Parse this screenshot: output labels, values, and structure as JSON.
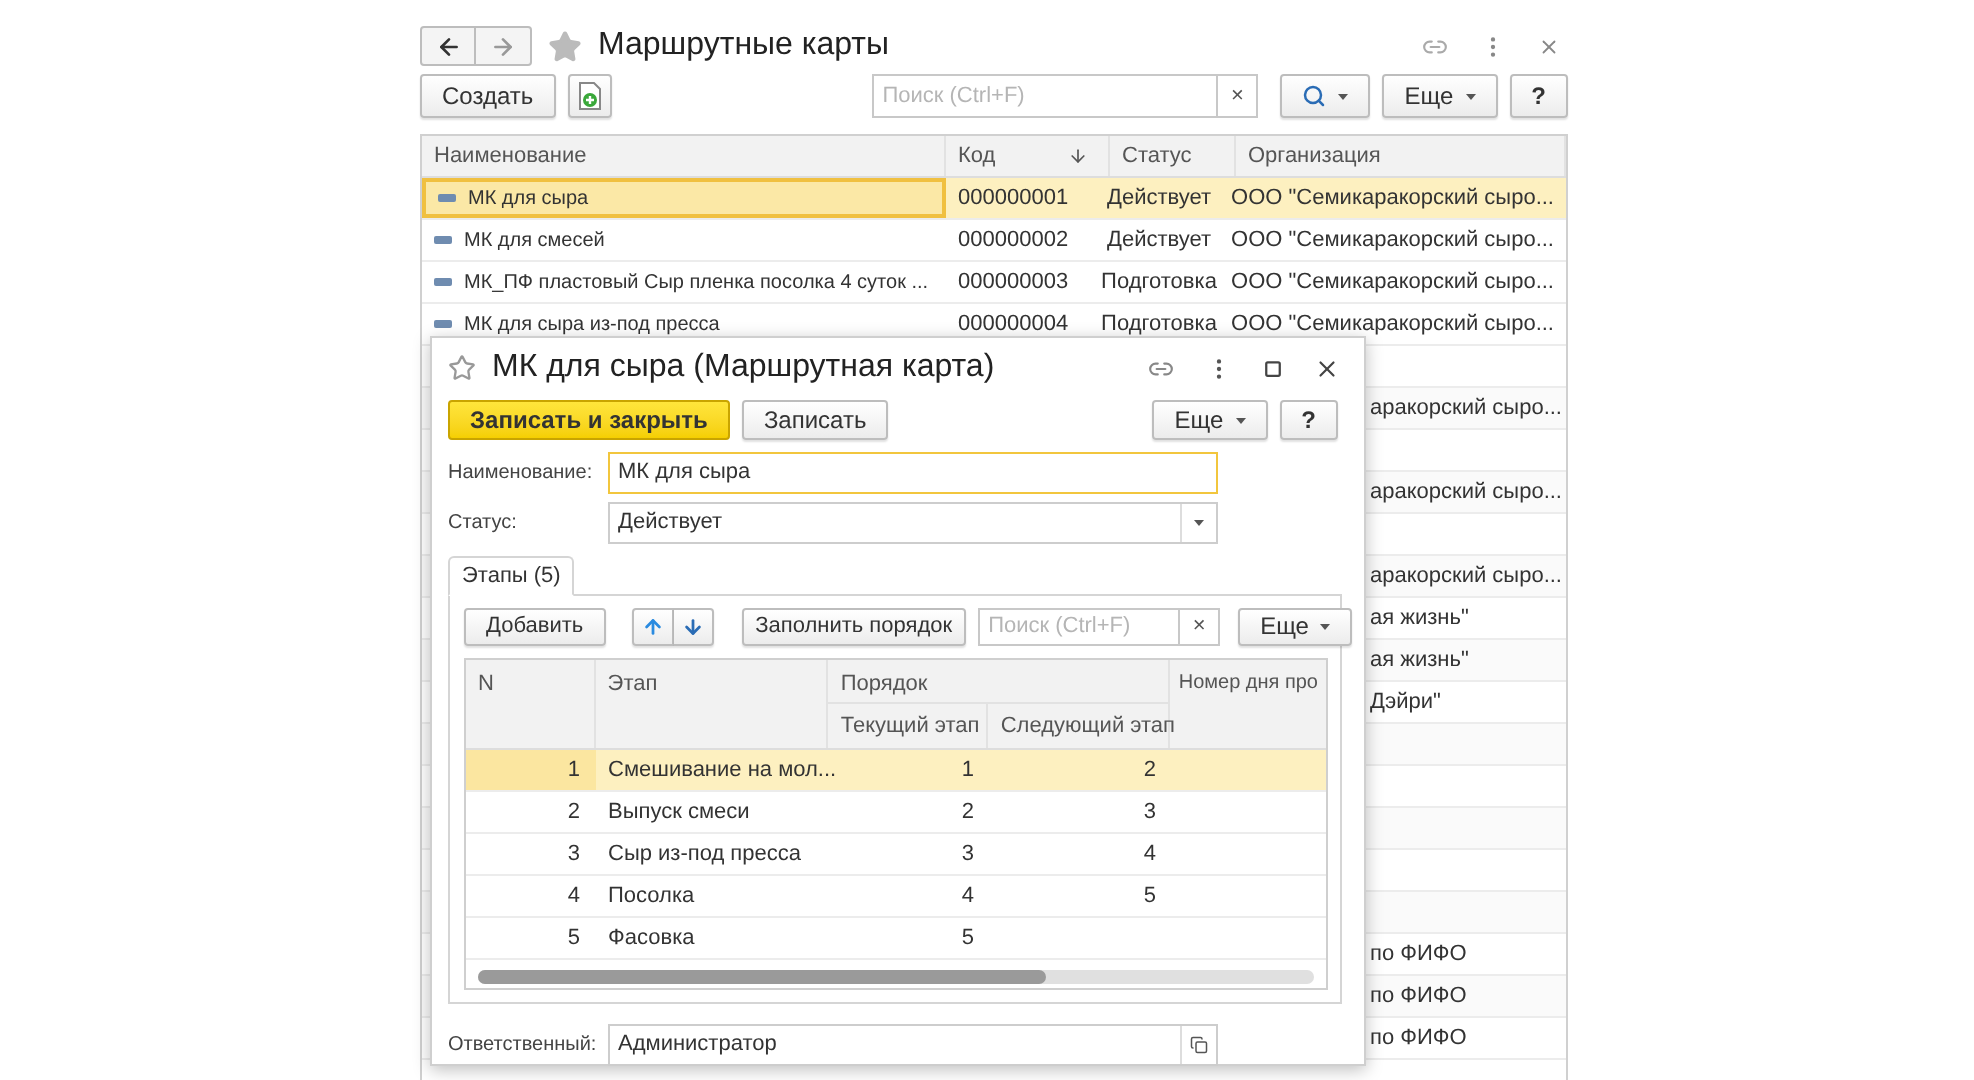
{
  "window": {
    "title": "Маршрутные карты",
    "favorite": false
  },
  "toolbar": {
    "create_button": "Создать",
    "search": {
      "placeholder": "Поиск (Ctrl+F)"
    },
    "clear_button": "×",
    "more_button": "Еще",
    "help_button": "?"
  },
  "list": {
    "columns": [
      {
        "label": "Наименование",
        "sorted": false
      },
      {
        "label": "Код",
        "sorted": true
      },
      {
        "label": "Статус",
        "sorted": false
      },
      {
        "label": "Организация",
        "sorted": false
      }
    ],
    "rows": [
      {
        "name": "МК для сыра",
        "code": "000000001",
        "status": "Действует",
        "organization": "ООО \"Семикаракорский сыро...",
        "selected": true
      },
      {
        "name": "МК для смесей",
        "code": "000000002",
        "status": "Действует",
        "organization": "ООО \"Семикаракорский сыро...",
        "selected": false
      },
      {
        "name": "МК_ПФ пластовый Сыр пленка посолка 4 суток ...",
        "code": "000000003",
        "status": "Подготовка",
        "organization": "ООО \"Семикаракорский сыро...",
        "selected": false
      },
      {
        "name": "МК для сыра из-под пресса",
        "code": "000000004",
        "status": "Подготовка",
        "organization": "ООО \"Семикаракорский сыро...",
        "selected": false
      }
    ],
    "covered_rows": [
      {},
      {
        "organization": "аракорский сыро..."
      },
      {},
      {
        "organization": "аракорский сыро..."
      },
      {},
      {
        "organization": "аракорский сыро..."
      },
      {
        "organization": "ая жизнь\""
      },
      {
        "organization": "ая жизнь\""
      },
      {
        "organization": "Дэйри\""
      },
      {},
      {},
      {},
      {},
      {},
      {
        "organization": "по ФИФО"
      },
      {
        "organization": "по ФИФО"
      },
      {
        "organization": "по ФИФО"
      }
    ]
  },
  "dialog": {
    "title": "МК для сыра (Маршрутная карта)",
    "favorite": false,
    "save_close_button": "Записать и закрыть",
    "save_button": "Записать",
    "more_button": "Еще",
    "help_button": "?",
    "fields": [
      {
        "label": "Наименование:",
        "value": "МК для сыра",
        "kind": "text",
        "focused": true
      },
      {
        "label": "Статус:",
        "value": "Действует",
        "kind": "select",
        "focused": false
      }
    ],
    "tabs": [
      {
        "label": "Этапы (5)",
        "selected": true
      }
    ],
    "stages_toolbar": {
      "add_button": "Добавить",
      "fill_order_button": "Заполнить порядок",
      "search": {
        "placeholder": "Поиск (Ctrl+F)"
      },
      "clear_button": "×",
      "more_button": "Еще"
    },
    "stages_table": {
      "columns": [
        "N",
        "Этап",
        "Номер дня про"
      ],
      "group": {
        "label": "Порядок",
        "columns": [
          "Текущий этап",
          "Следующий этап"
        ]
      },
      "rows": [
        {
          "n": "1",
          "stage": "Смешивание на мол...",
          "current": "1",
          "next": "2",
          "selected": true
        },
        {
          "n": "2",
          "stage": "Выпуск смеси",
          "current": "2",
          "next": "3",
          "selected": false
        },
        {
          "n": "3",
          "stage": "Сыр из-под пресса",
          "current": "3",
          "next": "4",
          "selected": false
        },
        {
          "n": "4",
          "stage": "Посолка",
          "current": "4",
          "next": "5",
          "selected": false
        },
        {
          "n": "5",
          "stage": "Фасовка",
          "current": "5",
          "selected": false
        }
      ]
    },
    "responsible": {
      "label": "Ответственный:",
      "value": "Администратор"
    }
  }
}
